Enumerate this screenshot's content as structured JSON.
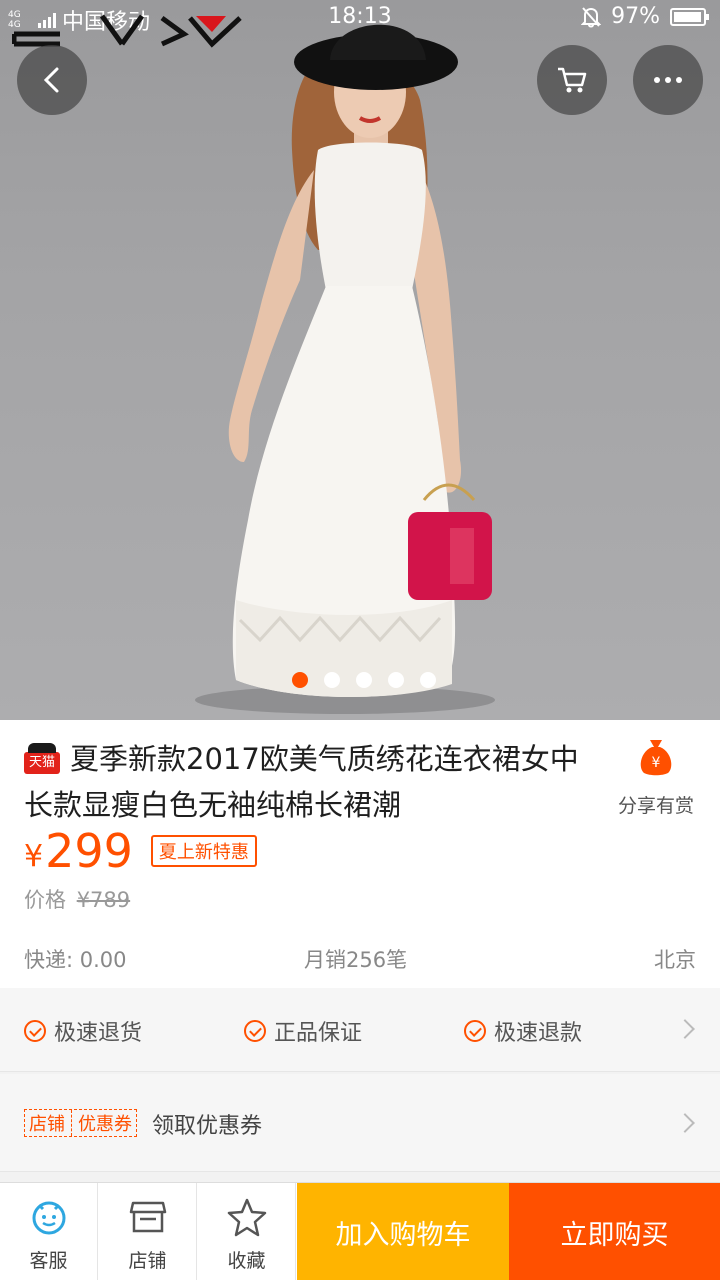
{
  "status_bar": {
    "network": "4G 4G",
    "carrier": "中国移动",
    "time": "18:13",
    "battery": "97%",
    "battery_level": 0.97
  },
  "top_bar": {
    "back_icon": "back-icon",
    "cart_icon": "cart-icon",
    "more_icon": "more-icon"
  },
  "gallery": {
    "image_count": 5,
    "active_index": 0,
    "accent_color": "#ff5000"
  },
  "product": {
    "badge": "天猫",
    "title": "夏季新款2017欧美气质绣花连衣裙女中长款显瘦白色无袖纯棉长裙潮",
    "share_label": "分享有赏",
    "currency": "¥",
    "price": "299",
    "promo": "夏上新特惠",
    "original_price_label": "价格",
    "original_price": "¥789",
    "shipping": "快递: 0.00",
    "monthly_sales": "月销256笔",
    "location": "北京"
  },
  "guarantees": {
    "items": [
      "极速退货",
      "正品保证",
      "极速退款"
    ]
  },
  "coupon": {
    "tag_left": "店铺",
    "tag_right": "优惠券",
    "label": "领取优惠券"
  },
  "bottom_bar": {
    "service": "客服",
    "shop": "店铺",
    "favorite": "收藏",
    "add_to_cart": "加入购物车",
    "buy_now": "立即购买",
    "cart_color": "#ffb400",
    "buy_color": "#ff5000"
  }
}
